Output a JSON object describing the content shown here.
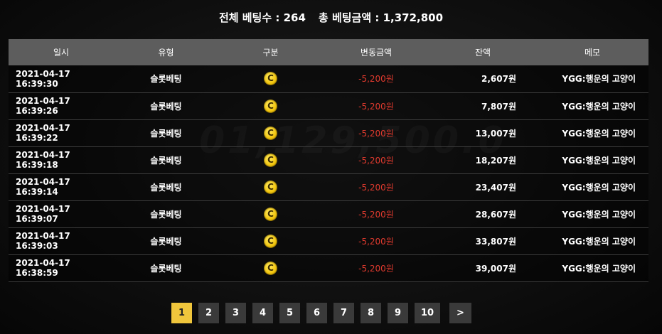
{
  "summary": {
    "total_bets_label": "전체 베팅수 : ",
    "total_bets_value": "264",
    "total_amount_label": "총 베팅금액 : ",
    "total_amount_value": "1,372,800"
  },
  "table": {
    "headers": [
      "일시",
      "유형",
      "구분",
      "변동금액",
      "잔액",
      "메모"
    ],
    "coin_symbol": "C",
    "rows": [
      {
        "datetime": "2021-04-17 16:39:30",
        "type": "슬롯베팅",
        "amount": "-5,200원",
        "balance": "2,607원",
        "memo": "YGG:행운의 고양이"
      },
      {
        "datetime": "2021-04-17 16:39:26",
        "type": "슬롯베팅",
        "amount": "-5,200원",
        "balance": "7,807원",
        "memo": "YGG:행운의 고양이"
      },
      {
        "datetime": "2021-04-17 16:39:22",
        "type": "슬롯베팅",
        "amount": "-5,200원",
        "balance": "13,007원",
        "memo": "YGG:행운의 고양이"
      },
      {
        "datetime": "2021-04-17 16:39:18",
        "type": "슬롯베팅",
        "amount": "-5,200원",
        "balance": "18,207원",
        "memo": "YGG:행운의 고양이"
      },
      {
        "datetime": "2021-04-17 16:39:14",
        "type": "슬롯베팅",
        "amount": "-5,200원",
        "balance": "23,407원",
        "memo": "YGG:행운의 고양이"
      },
      {
        "datetime": "2021-04-17 16:39:07",
        "type": "슬롯베팅",
        "amount": "-5,200원",
        "balance": "28,607원",
        "memo": "YGG:행운의 고양이"
      },
      {
        "datetime": "2021-04-17 16:39:03",
        "type": "슬롯베팅",
        "amount": "-5,200원",
        "balance": "33,807원",
        "memo": "YGG:행운의 고양이"
      },
      {
        "datetime": "2021-04-17 16:38:59",
        "type": "슬롯베팅",
        "amount": "-5,200원",
        "balance": "39,007원",
        "memo": "YGG:행운의 고양이"
      }
    ]
  },
  "pagination": {
    "pages": [
      "1",
      "2",
      "3",
      "4",
      "5",
      "6",
      "7",
      "8",
      "9",
      "10"
    ],
    "active": "1",
    "next_label": ">"
  },
  "colors": {
    "accent": "#f0c63c",
    "negative_amount": "#e03a2e",
    "header_bg": "#5d5d5d"
  },
  "background": {
    "jackpot_text": "01,129,500.0"
  }
}
